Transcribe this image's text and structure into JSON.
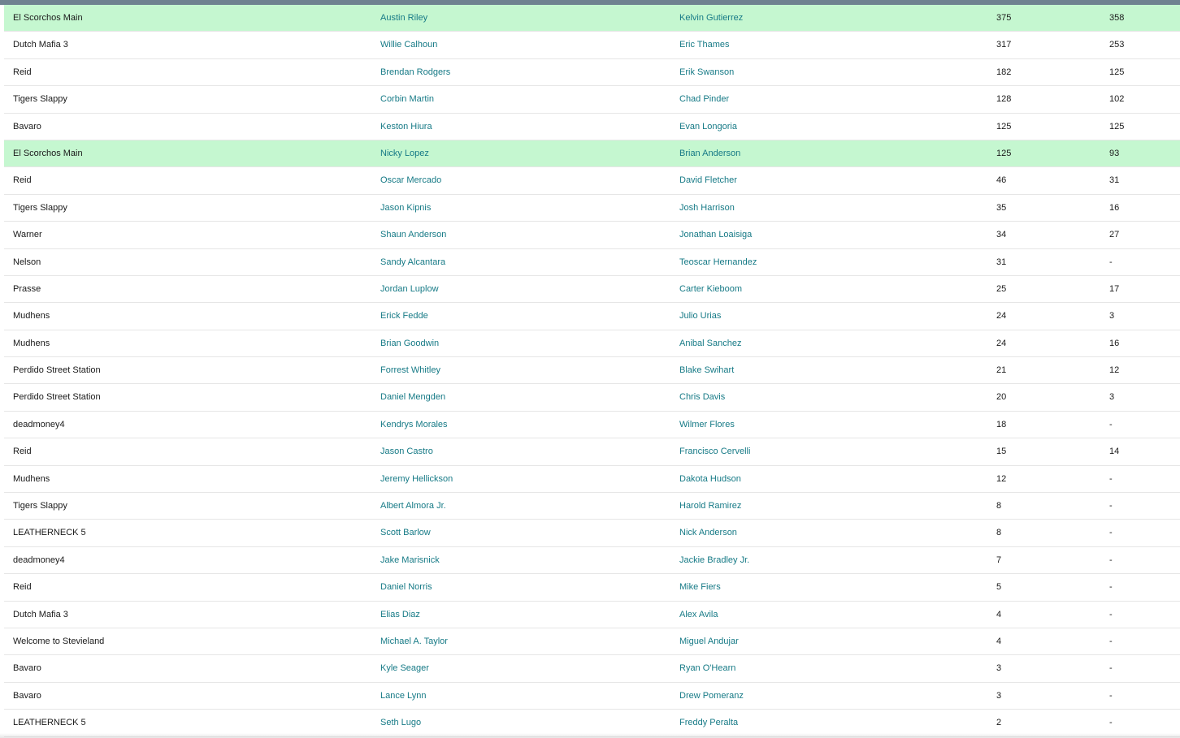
{
  "colors": {
    "highlight_row": "#c5f7d0",
    "link": "#167a86",
    "top_bar": "#6f8290"
  },
  "rows": [
    {
      "team": "El Scorchos Main",
      "player1": "Austin Riley",
      "player2": "Kelvin Gutierrez",
      "val1": "375",
      "val2": "358",
      "highlight": true
    },
    {
      "team": "Dutch Mafia 3",
      "player1": "Willie Calhoun",
      "player2": "Eric Thames",
      "val1": "317",
      "val2": "253",
      "highlight": false
    },
    {
      "team": "Reid",
      "player1": "Brendan Rodgers",
      "player2": "Erik Swanson",
      "val1": "182",
      "val2": "125",
      "highlight": false
    },
    {
      "team": "Tigers Slappy",
      "player1": "Corbin Martin",
      "player2": "Chad Pinder",
      "val1": "128",
      "val2": "102",
      "highlight": false
    },
    {
      "team": "Bavaro",
      "player1": "Keston Hiura",
      "player2": "Evan Longoria",
      "val1": "125",
      "val2": "125",
      "highlight": false
    },
    {
      "team": "El Scorchos Main",
      "player1": "Nicky Lopez",
      "player2": "Brian Anderson",
      "val1": "125",
      "val2": "93",
      "highlight": true
    },
    {
      "team": "Reid",
      "player1": "Oscar Mercado",
      "player2": "David Fletcher",
      "val1": "46",
      "val2": "31",
      "highlight": false
    },
    {
      "team": "Tigers Slappy",
      "player1": "Jason Kipnis",
      "player2": "Josh Harrison",
      "val1": "35",
      "val2": "16",
      "highlight": false
    },
    {
      "team": "Warner",
      "player1": "Shaun Anderson",
      "player2": "Jonathan Loaisiga",
      "val1": "34",
      "val2": "27",
      "highlight": false
    },
    {
      "team": "Nelson",
      "player1": "Sandy Alcantara",
      "player2": "Teoscar Hernandez",
      "val1": "31",
      "val2": "-",
      "highlight": false
    },
    {
      "team": "Prasse",
      "player1": "Jordan Luplow",
      "player2": "Carter Kieboom",
      "val1": "25",
      "val2": "17",
      "highlight": false
    },
    {
      "team": "Mudhens",
      "player1": "Erick Fedde",
      "player2": "Julio Urias",
      "val1": "24",
      "val2": "3",
      "highlight": false
    },
    {
      "team": "Mudhens",
      "player1": "Brian Goodwin",
      "player2": "Anibal Sanchez",
      "val1": "24",
      "val2": "16",
      "highlight": false
    },
    {
      "team": "Perdido Street Station",
      "player1": "Forrest Whitley",
      "player2": "Blake Swihart",
      "val1": "21",
      "val2": "12",
      "highlight": false
    },
    {
      "team": "Perdido Street Station",
      "player1": "Daniel Mengden",
      "player2": "Chris Davis",
      "val1": "20",
      "val2": "3",
      "highlight": false
    },
    {
      "team": "deadmoney4",
      "player1": "Kendrys Morales",
      "player2": "Wilmer Flores",
      "val1": "18",
      "val2": "-",
      "highlight": false
    },
    {
      "team": "Reid",
      "player1": "Jason Castro",
      "player2": "Francisco Cervelli",
      "val1": "15",
      "val2": "14",
      "highlight": false
    },
    {
      "team": "Mudhens",
      "player1": "Jeremy Hellickson",
      "player2": "Dakota Hudson",
      "val1": "12",
      "val2": "-",
      "highlight": false
    },
    {
      "team": "Tigers Slappy",
      "player1": "Albert Almora Jr.",
      "player2": "Harold Ramirez",
      "val1": "8",
      "val2": "-",
      "highlight": false
    },
    {
      "team": "LEATHERNECK 5",
      "player1": "Scott Barlow",
      "player2": "Nick Anderson",
      "val1": "8",
      "val2": "-",
      "highlight": false
    },
    {
      "team": "deadmoney4",
      "player1": "Jake Marisnick",
      "player2": "Jackie Bradley Jr.",
      "val1": "7",
      "val2": "-",
      "highlight": false
    },
    {
      "team": "Reid",
      "player1": "Daniel Norris",
      "player2": "Mike Fiers",
      "val1": "5",
      "val2": "-",
      "highlight": false
    },
    {
      "team": "Dutch Mafia 3",
      "player1": "Elias Diaz",
      "player2": "Alex Avila",
      "val1": "4",
      "val2": "-",
      "highlight": false
    },
    {
      "team": "Welcome to Stevieland",
      "player1": "Michael A. Taylor",
      "player2": "Miguel Andujar",
      "val1": "4",
      "val2": "-",
      "highlight": false
    },
    {
      "team": "Bavaro",
      "player1": "Kyle Seager",
      "player2": "Ryan O'Hearn",
      "val1": "3",
      "val2": "-",
      "highlight": false
    },
    {
      "team": "Bavaro",
      "player1": "Lance Lynn",
      "player2": "Drew Pomeranz",
      "val1": "3",
      "val2": "-",
      "highlight": false
    },
    {
      "team": "LEATHERNECK 5",
      "player1": "Seth Lugo",
      "player2": "Freddy Peralta",
      "val1": "2",
      "val2": "-",
      "highlight": false
    }
  ]
}
